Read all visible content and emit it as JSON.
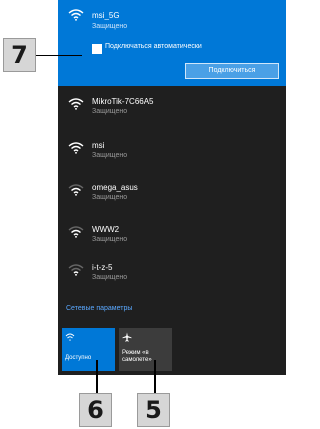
{
  "selected_network": {
    "ssid": "msi_5G",
    "status": "Защищено",
    "auto_connect_label": "Подключаться автоматически",
    "connect_label": "Подключиться"
  },
  "networks": [
    {
      "ssid": "MikroTik-7C66A5",
      "status": "Защищено"
    },
    {
      "ssid": "msi",
      "status": "Защищено"
    },
    {
      "ssid": "omega_asus",
      "status": "Защищено"
    },
    {
      "ssid": "WWW2",
      "status": "Защищено"
    },
    {
      "ssid": "i-t-z-5",
      "status": "Защищено"
    }
  ],
  "settings_link": "Сетевые параметры",
  "tiles": {
    "wifi": {
      "label": "Доступно",
      "icon": "wifi-icon"
    },
    "airplane": {
      "label": "Режим «в самолете»",
      "icon": "airplane-icon"
    }
  },
  "callouts": {
    "seven": "7",
    "six": "6",
    "five": "5"
  },
  "colors": {
    "accent": "#0078d7",
    "panel": "#1f1f1f",
    "callout_bg": "#d6d6d6"
  }
}
